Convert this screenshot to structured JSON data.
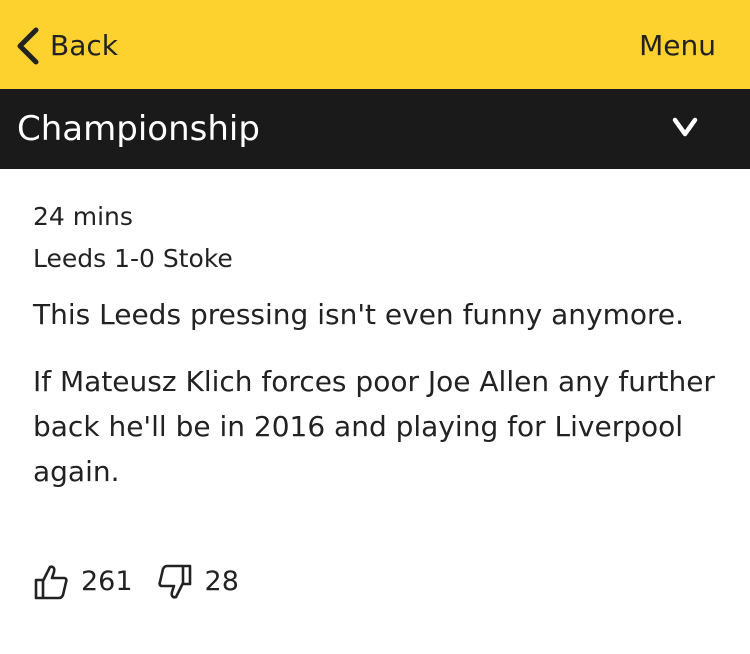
{
  "topbar": {
    "back_label": "Back",
    "menu_label": "Menu",
    "color": "#fdd12e"
  },
  "section": {
    "title": "Championship",
    "icon": "chevron-down-icon"
  },
  "post": {
    "time": "24 mins",
    "score": "Leeds 1-0 Stoke",
    "paragraphs": [
      "This Leeds pressing isn't even funny anymore.",
      "If Mateusz Klich forces poor Joe Allen any further back he'll be in 2016 and playing for Liverpool again."
    ],
    "reactions": {
      "likes": "261",
      "dislikes": "28"
    }
  }
}
